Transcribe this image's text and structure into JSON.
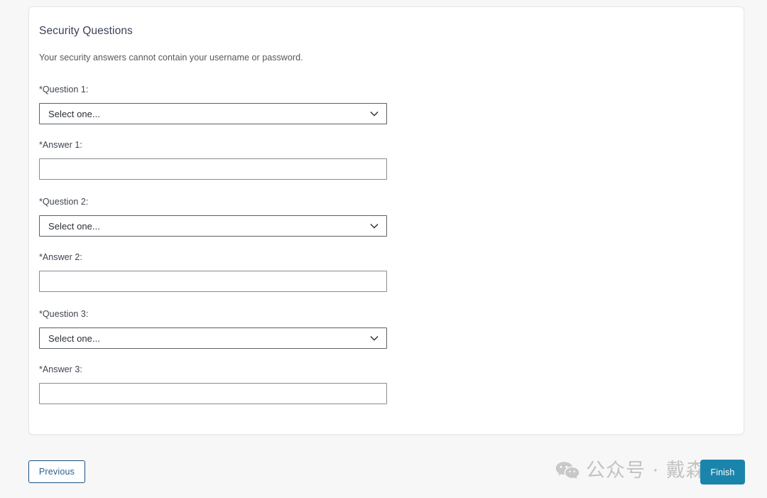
{
  "card": {
    "title": "Security Questions",
    "subtitle": "Your security answers cannot contain your username or password."
  },
  "form": {
    "groups": [
      {
        "question_label": "*Question 1:",
        "question_value": "Select one...",
        "answer_label": "*Answer 1:",
        "answer_value": "",
        "answer_placeholder": ""
      },
      {
        "question_label": "*Question 2:",
        "question_value": "Select one...",
        "answer_label": "*Answer 2:",
        "answer_value": "",
        "answer_placeholder": ""
      },
      {
        "question_label": "*Question 3:",
        "question_value": "Select one...",
        "answer_label": "*Answer 3:",
        "answer_value": "",
        "answer_placeholder": ""
      }
    ]
  },
  "footer": {
    "previous_label": "Previous",
    "finish_label": "Finish"
  },
  "watermark": {
    "text": "公众号 · 戴森云",
    "logo": "wechat-icon"
  },
  "colors": {
    "page_background": "#f7f7f8",
    "card_background": "#ffffff",
    "card_border": "#e6e6e8",
    "finish_button": "#1b84ab",
    "previous_border": "#1c4e7e",
    "previous_text": "#2b5e8e",
    "label_text": "#3f4450",
    "title_text": "#3c4257",
    "select_border": "#5e6064",
    "input_border": "#888b8f",
    "watermark_gray": "#c3c3c3"
  }
}
